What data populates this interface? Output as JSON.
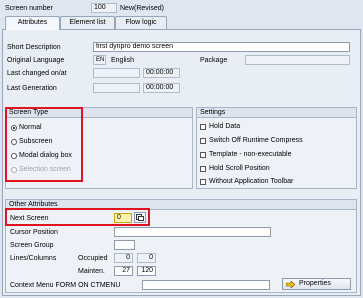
{
  "header": {
    "screen_number_label": "Screen number",
    "screen_number_value": "100",
    "status": "New(Revised)"
  },
  "tabs": [
    {
      "label": "Attributes",
      "active": true
    },
    {
      "label": "Element list",
      "active": false
    },
    {
      "label": "Flow logic",
      "active": false
    }
  ],
  "attributes": {
    "short_description_label": "Short Description",
    "short_description_value": "first dynpro demo screen",
    "original_language_label": "Original Language",
    "language_code": "EN",
    "language_name": "English",
    "package_label": "Package",
    "package_value": "",
    "last_changed_label": "Last changed on/at",
    "last_changed_date": "",
    "last_changed_time": "00:00:00",
    "last_generation_label": "Last Generation",
    "last_generation_date": "",
    "last_generation_time": "00:00:00"
  },
  "screen_type": {
    "title": "Screen Type",
    "options": [
      {
        "label": "Normal",
        "selected": true,
        "enabled": true
      },
      {
        "label": "Subscreen",
        "selected": false,
        "enabled": true
      },
      {
        "label": "Modal dialog box",
        "selected": false,
        "enabled": true
      },
      {
        "label": "Selection screen",
        "selected": false,
        "enabled": false
      }
    ]
  },
  "settings": {
    "title": "Settings",
    "options": [
      {
        "label": "Hold Data",
        "checked": false
      },
      {
        "label": "Switch Off Runtime Compress",
        "checked": false
      },
      {
        "label": "Template - non-executable",
        "checked": false
      },
      {
        "label": "Hold Scroll Position",
        "checked": false
      },
      {
        "label": "Without Application Toolbar",
        "checked": false
      }
    ]
  },
  "other_attributes": {
    "title": "Other Attributes",
    "next_screen_label": "Next Screen",
    "next_screen_value": "0",
    "cursor_position_label": "Cursor Position",
    "cursor_position_value": "",
    "screen_group_label": "Screen Group",
    "screen_group_value": "",
    "lines_columns_label": "Lines/Columns",
    "occupied_label": "Occupied",
    "occupied_lines": "0",
    "occupied_cols": "0",
    "mainten_label": "Mainten.",
    "mainten_lines": "27",
    "mainten_cols": "120",
    "context_menu_label": "Context Menu FORM ON CTMENU",
    "context_menu_value": "",
    "properties_button": "Properties"
  },
  "colors": {
    "highlight_red": "#e0141e",
    "input_active": "#fff3b0",
    "arrow_icon": "#f0c000"
  }
}
